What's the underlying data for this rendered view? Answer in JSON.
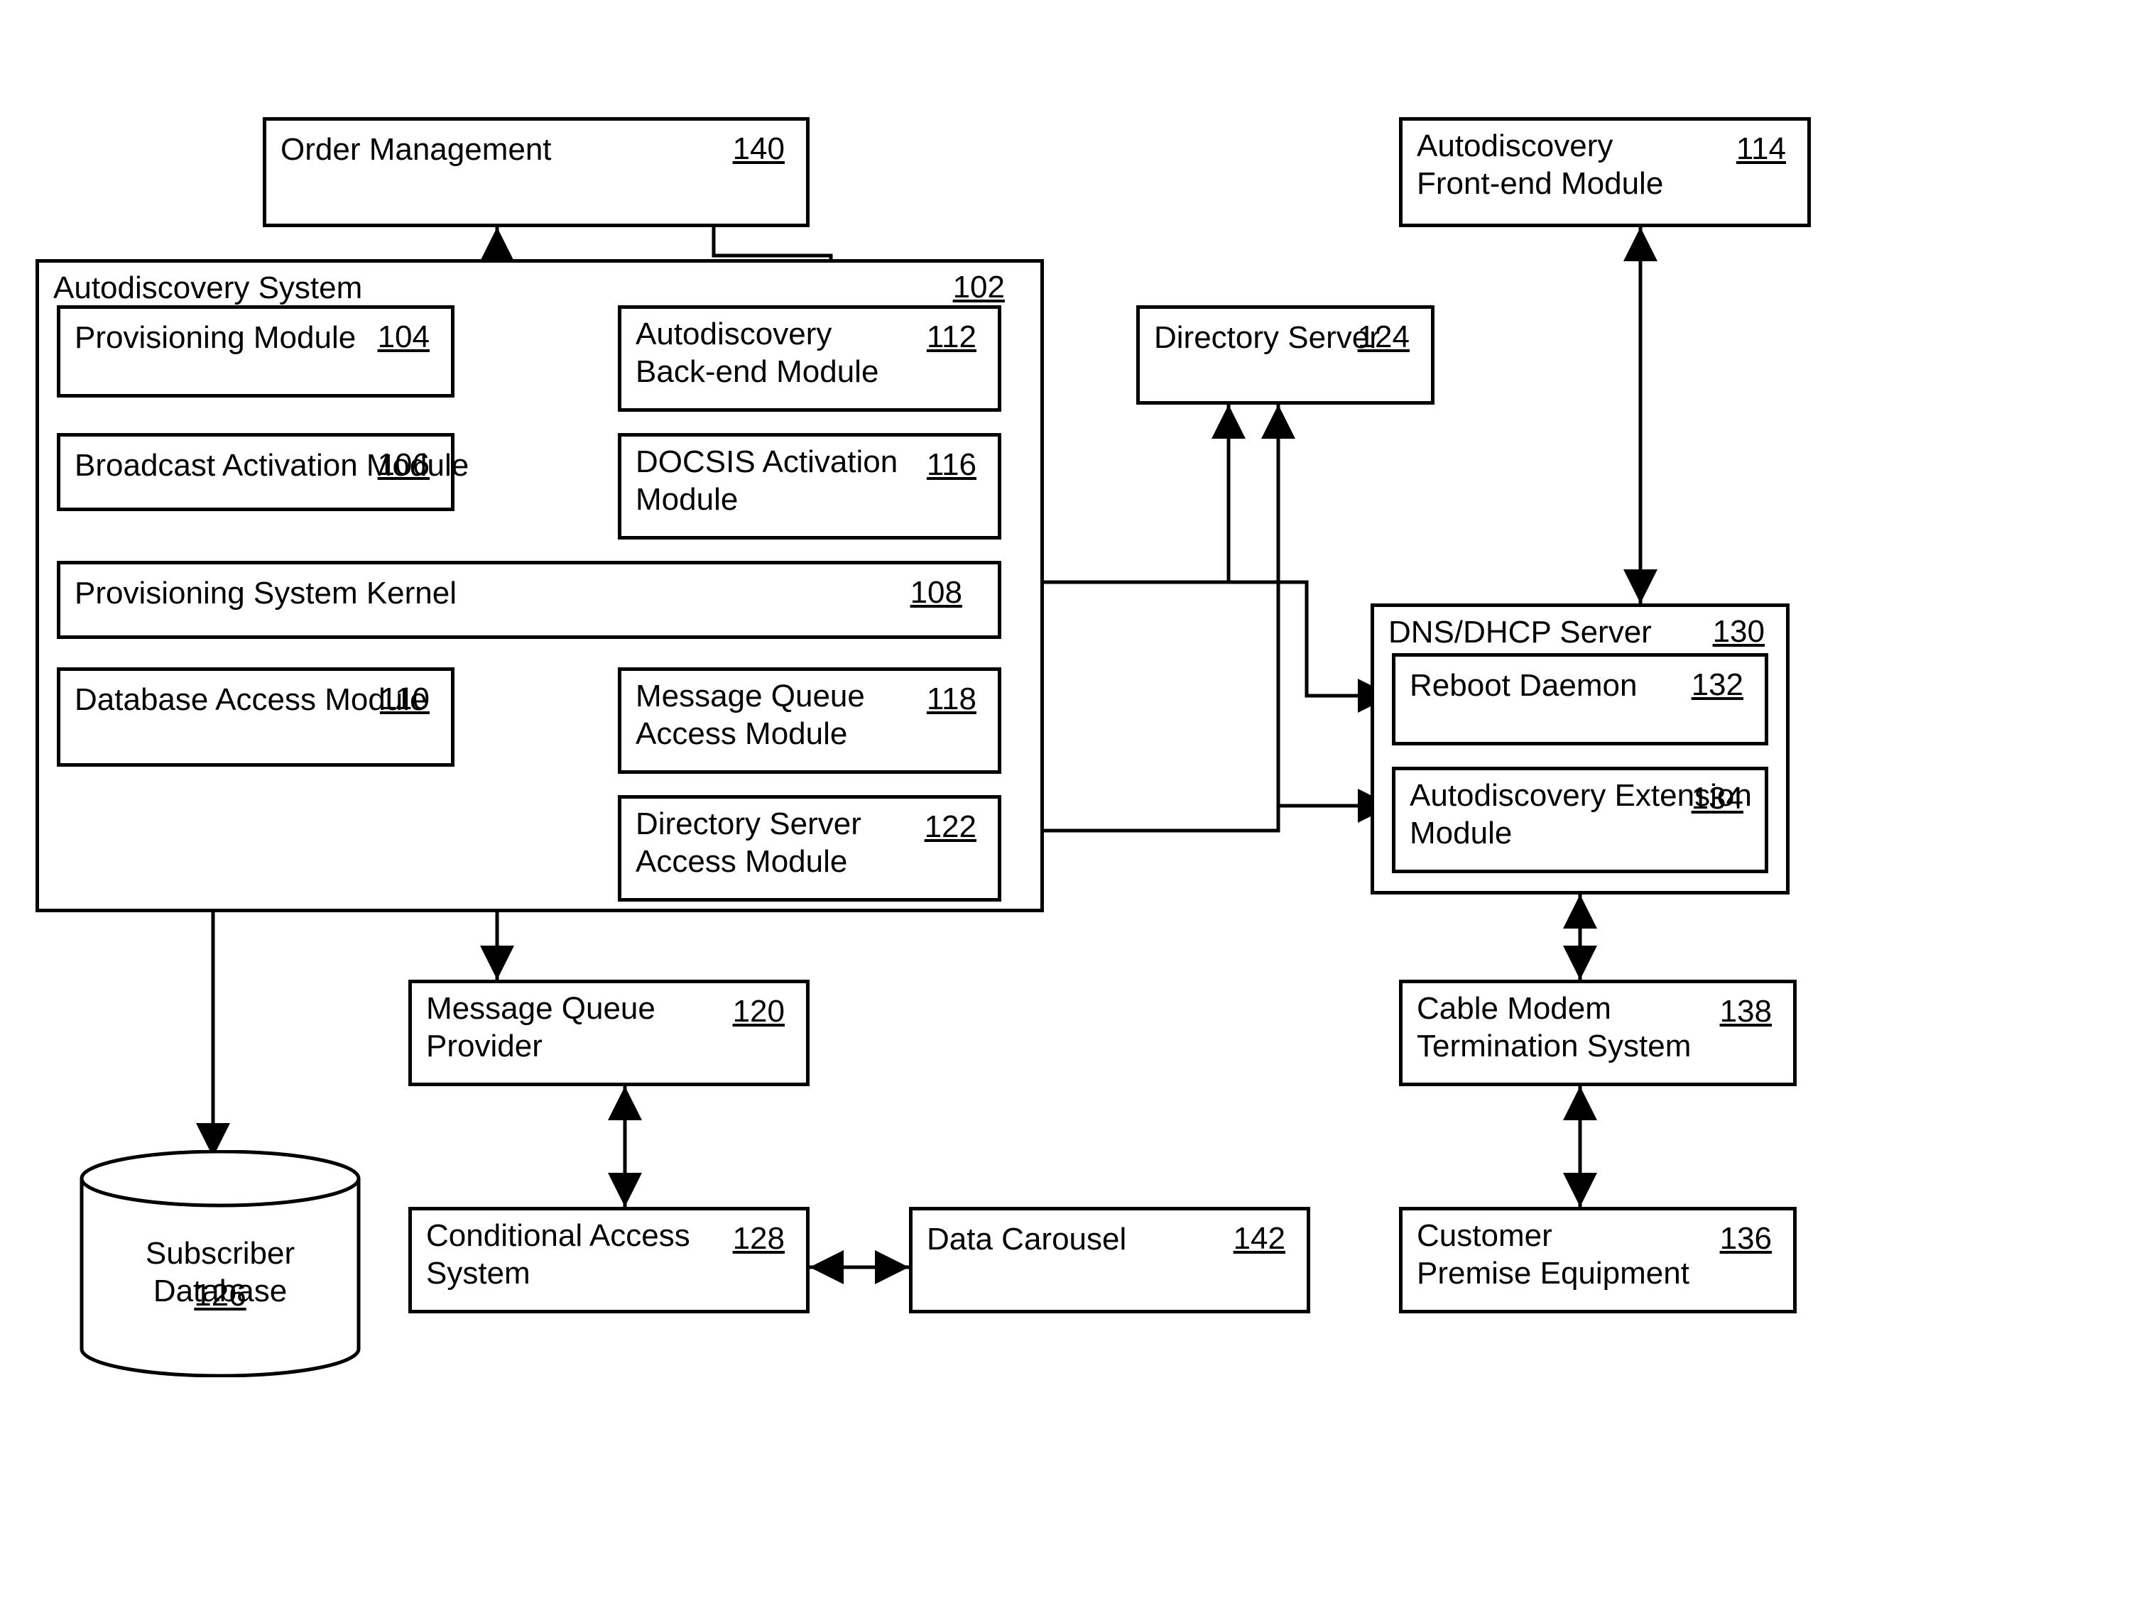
{
  "boxes": {
    "order_mgmt": {
      "label": "Order Management",
      "ref": "140"
    },
    "ad_frontend": {
      "label": "Autodiscovery\nFront-end Module",
      "ref": "114"
    },
    "ad_system": {
      "label": "Autodiscovery System",
      "ref": "102"
    },
    "prov_module": {
      "label": "Provisioning Module",
      "ref": "104"
    },
    "ad_backend": {
      "label": "Autodiscovery\nBack-end Module",
      "ref": "112"
    },
    "broadcast": {
      "label": "Broadcast Activation Module",
      "ref": "106"
    },
    "docsis": {
      "label": "DOCSIS Activation\nModule",
      "ref": "116"
    },
    "psk": {
      "label": "Provisioning System Kernel",
      "ref": "108"
    },
    "db_access": {
      "label": "Database Access Module",
      "ref": "110"
    },
    "mq_access": {
      "label": "Message Queue\nAccess Module",
      "ref": "118"
    },
    "ds_access": {
      "label": "Directory Server\nAccess Module",
      "ref": "122"
    },
    "dir_server": {
      "label": "Directory Server",
      "ref": "124"
    },
    "dns_dhcp": {
      "label": "DNS/DHCP Server",
      "ref": "130"
    },
    "reboot": {
      "label": "Reboot Daemon",
      "ref": "132"
    },
    "ad_ext": {
      "label": "Autodiscovery Extension\nModule",
      "ref": "134"
    },
    "mq_provider": {
      "label": "Message Queue\nProvider",
      "ref": "120"
    },
    "cas": {
      "label": "Conditional Access\nSystem",
      "ref": "128"
    },
    "carousel": {
      "label": "Data Carousel",
      "ref": "142"
    },
    "cmts": {
      "label": "Cable Modem\nTermination System",
      "ref": "138"
    },
    "cpe": {
      "label": "Customer\nPremise Equipment",
      "ref": "136"
    },
    "sub_db": {
      "label": "Subscriber Database",
      "ref": "126"
    }
  }
}
